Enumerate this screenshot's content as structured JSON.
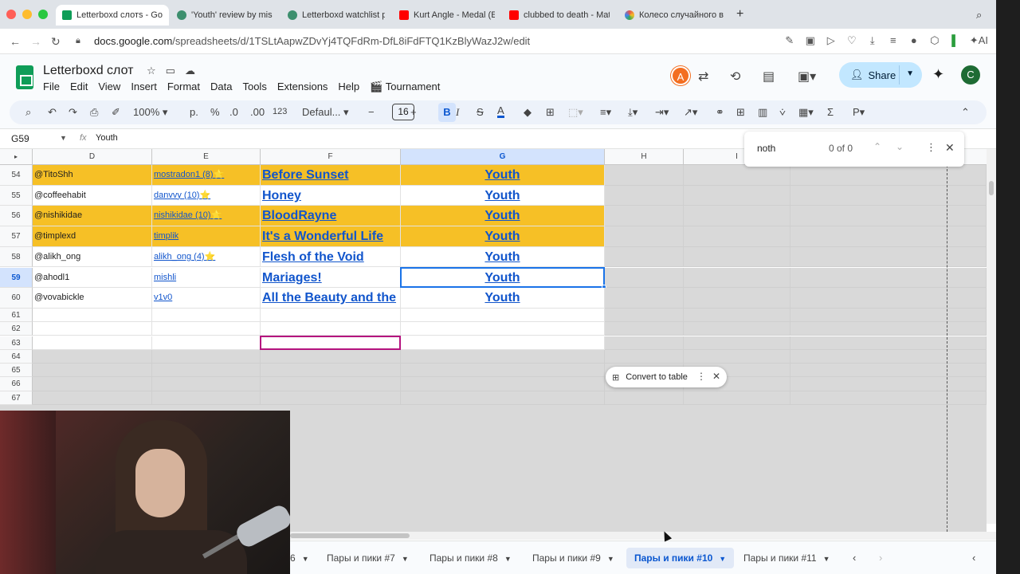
{
  "browser": {
    "tabs": [
      {
        "label": "Letterboxd слотs - Goo",
        "active": true,
        "color": "#0f9d58"
      },
      {
        "label": "'Youth' review by mishli",
        "active": false,
        "color": "#3d8f6e"
      },
      {
        "label": "Letterboxd watchlist pic",
        "active": false,
        "color": "#3d8f6e"
      },
      {
        "label": "Kurt Angle - Medal (Ent",
        "active": false,
        "color": "#ff0000"
      },
      {
        "label": "clubbed to death - Matri",
        "active": false,
        "color": "#ff0000"
      },
      {
        "label": "Колесо случайного вы",
        "active": false,
        "color": "#e5544b"
      }
    ],
    "new_tab": "+",
    "url_domain": "docs.google.com",
    "url_path": "/spreadsheets/d/1TSLtAapwZDvYj4TQFdRm-DfL8iFdFTQ1KzBlyWazJ2w/edit",
    "ai_label": "AI"
  },
  "sheets": {
    "title": "Letterboxd слот",
    "menus": [
      "File",
      "Edit",
      "View",
      "Insert",
      "Format",
      "Data",
      "Tools",
      "Extensions",
      "Help",
      "🎬 Tournament"
    ],
    "avatar_initial": "A",
    "share_label": "Share",
    "user_initial": "C",
    "toolbar": {
      "zoom": "100%",
      "currency": "р.",
      "percent": "%",
      "dec_decrease": ".0",
      "dec_increase": ".00",
      "number_format": "123",
      "font": "Defaul...",
      "font_size": "16",
      "bold": "B",
      "italic": "I",
      "strike": "S",
      "text_color": "A"
    },
    "name_box": "G59",
    "formula_value": "Youth"
  },
  "grid": {
    "columns": [
      "D",
      "E",
      "F",
      "G",
      "H",
      "I"
    ],
    "rows": [
      {
        "num": "54",
        "user": "@TitoShh",
        "reviewer": "mostradon1 (8)⭐",
        "film": "Before Sunset",
        "genre": "Youth",
        "highlight": true
      },
      {
        "num": "55",
        "user": "@coffeehabit",
        "reviewer": "danvvy (10)⭐",
        "film": "Honey",
        "genre": "Youth",
        "highlight": false
      },
      {
        "num": "56",
        "user": "@nishikidae",
        "reviewer": "nishikidae (10)⭐",
        "film": "BloodRayne",
        "genre": "Youth",
        "highlight": true
      },
      {
        "num": "57",
        "user": "@timplexd",
        "reviewer": "timplik",
        "film": "It's a Wonderful Life",
        "genre": "Youth",
        "highlight": true
      },
      {
        "num": "58",
        "user": "@alikh_ong",
        "reviewer": "alikh_ong (4)⭐",
        "film": "Flesh of the Void",
        "genre": "Youth",
        "highlight": false
      },
      {
        "num": "59",
        "user": "@ahodl1",
        "reviewer": "mishli",
        "film": "Mariages!",
        "genre": "Youth",
        "highlight": false
      },
      {
        "num": "60",
        "user": "@vovabickle",
        "reviewer": "v1v0",
        "film": "All the Beauty and the",
        "genre": "Youth",
        "highlight": false
      }
    ],
    "empty_rows": [
      "61",
      "62",
      "63",
      "64",
      "65",
      "66",
      "67"
    ],
    "highlight_color": "#f6c026",
    "link_color": "#1155cc"
  },
  "popups": {
    "convert_label": "Convert to table",
    "find_query": "noth",
    "find_count": "0 of 0"
  },
  "sheet_tabs": [
    {
      "label": "6",
      "active": false
    },
    {
      "label": "Пары и пики #7",
      "active": false
    },
    {
      "label": "Пары и пики #8",
      "active": false
    },
    {
      "label": "Пары и пики #9",
      "active": false
    },
    {
      "label": "Пары и пики #10",
      "active": true
    },
    {
      "label": "Пары и пики #11",
      "active": false
    }
  ]
}
